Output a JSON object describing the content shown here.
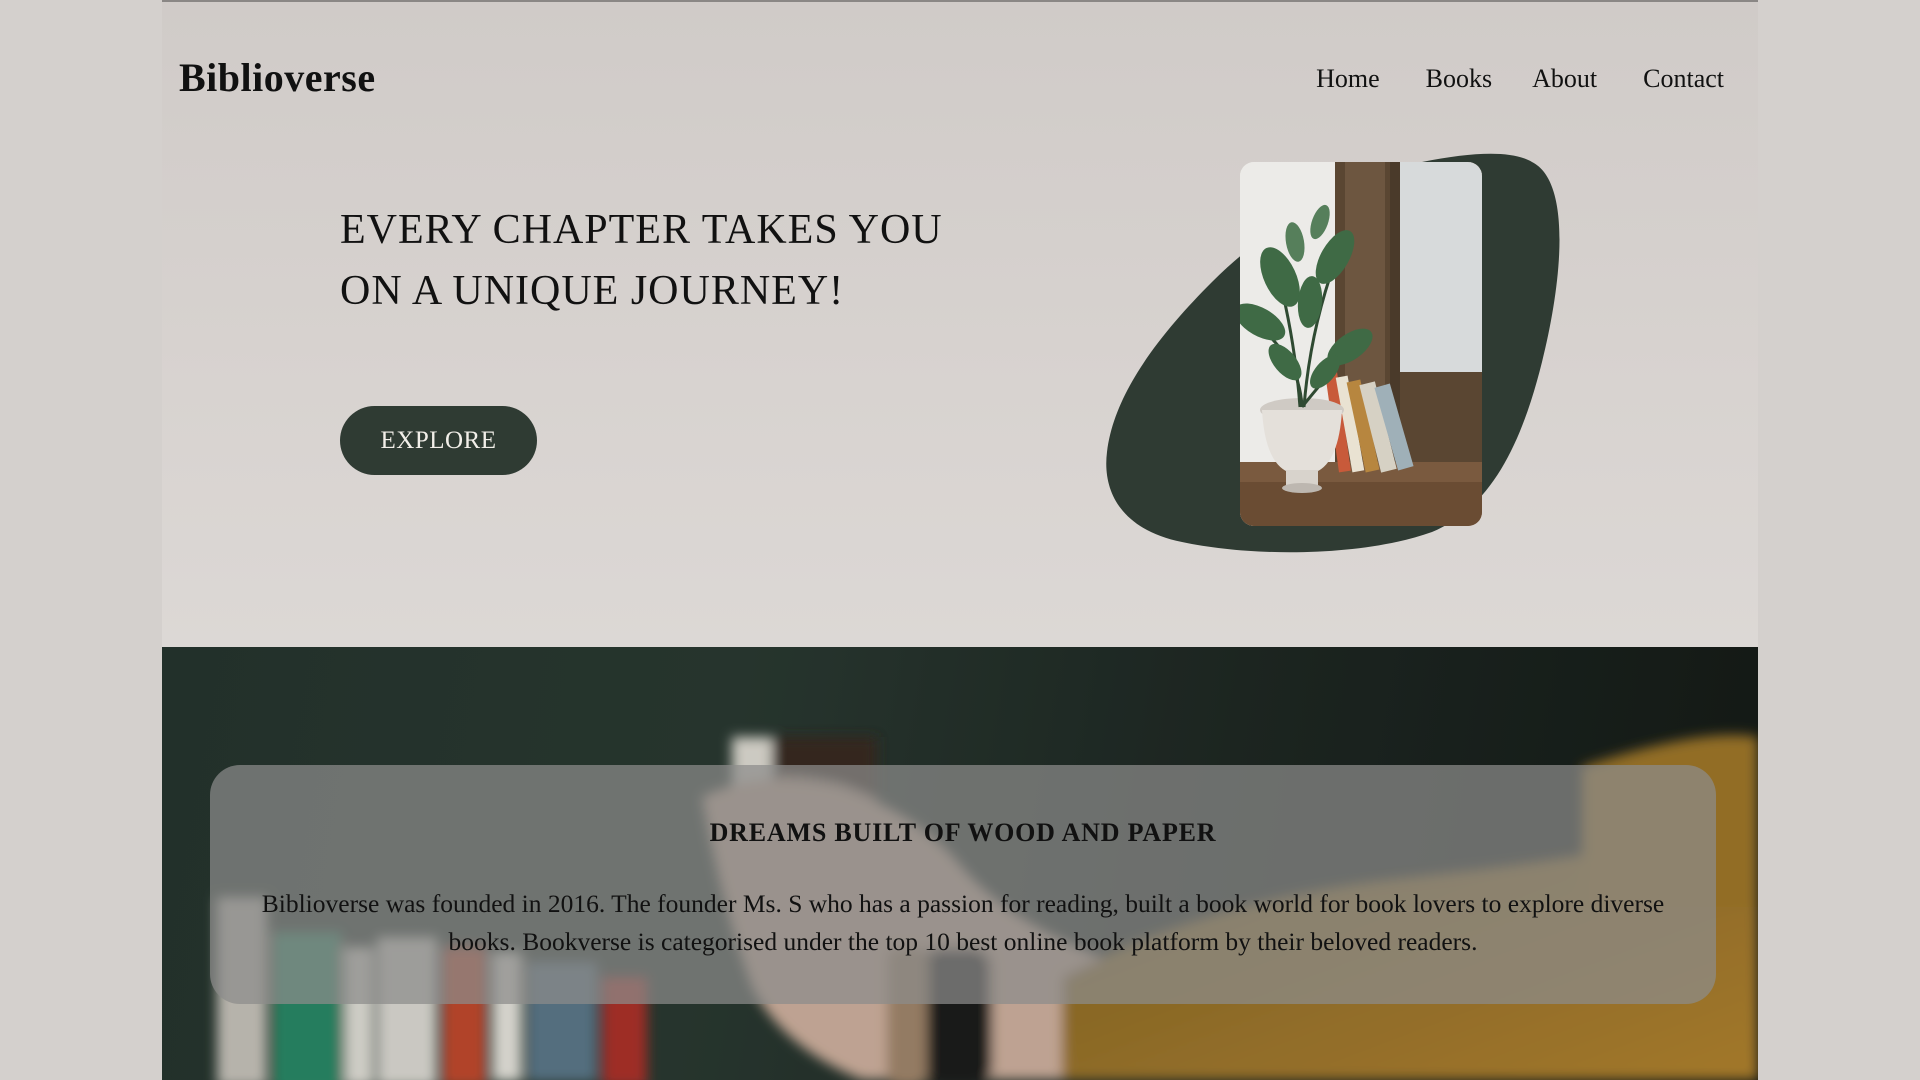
{
  "header": {
    "brand": "Biblioverse",
    "nav": [
      "Home",
      "Books",
      "About",
      "Contact"
    ]
  },
  "hero": {
    "headline": "EVERY CHAPTER TAKES YOU ON A UNIQUE JOURNEY!",
    "cta_label": "EXPLORE",
    "accent_color": "#2f3b33"
  },
  "about": {
    "title": "DREAMS BUILT OF WOOD AND PAPER",
    "body": "Biblioverse was founded in 2016. The founder Ms. S who has a passion for reading, built a book world for book lovers to explore diverse books. Bookverse is categorised under the top 10 best online book platform by their beloved readers."
  }
}
